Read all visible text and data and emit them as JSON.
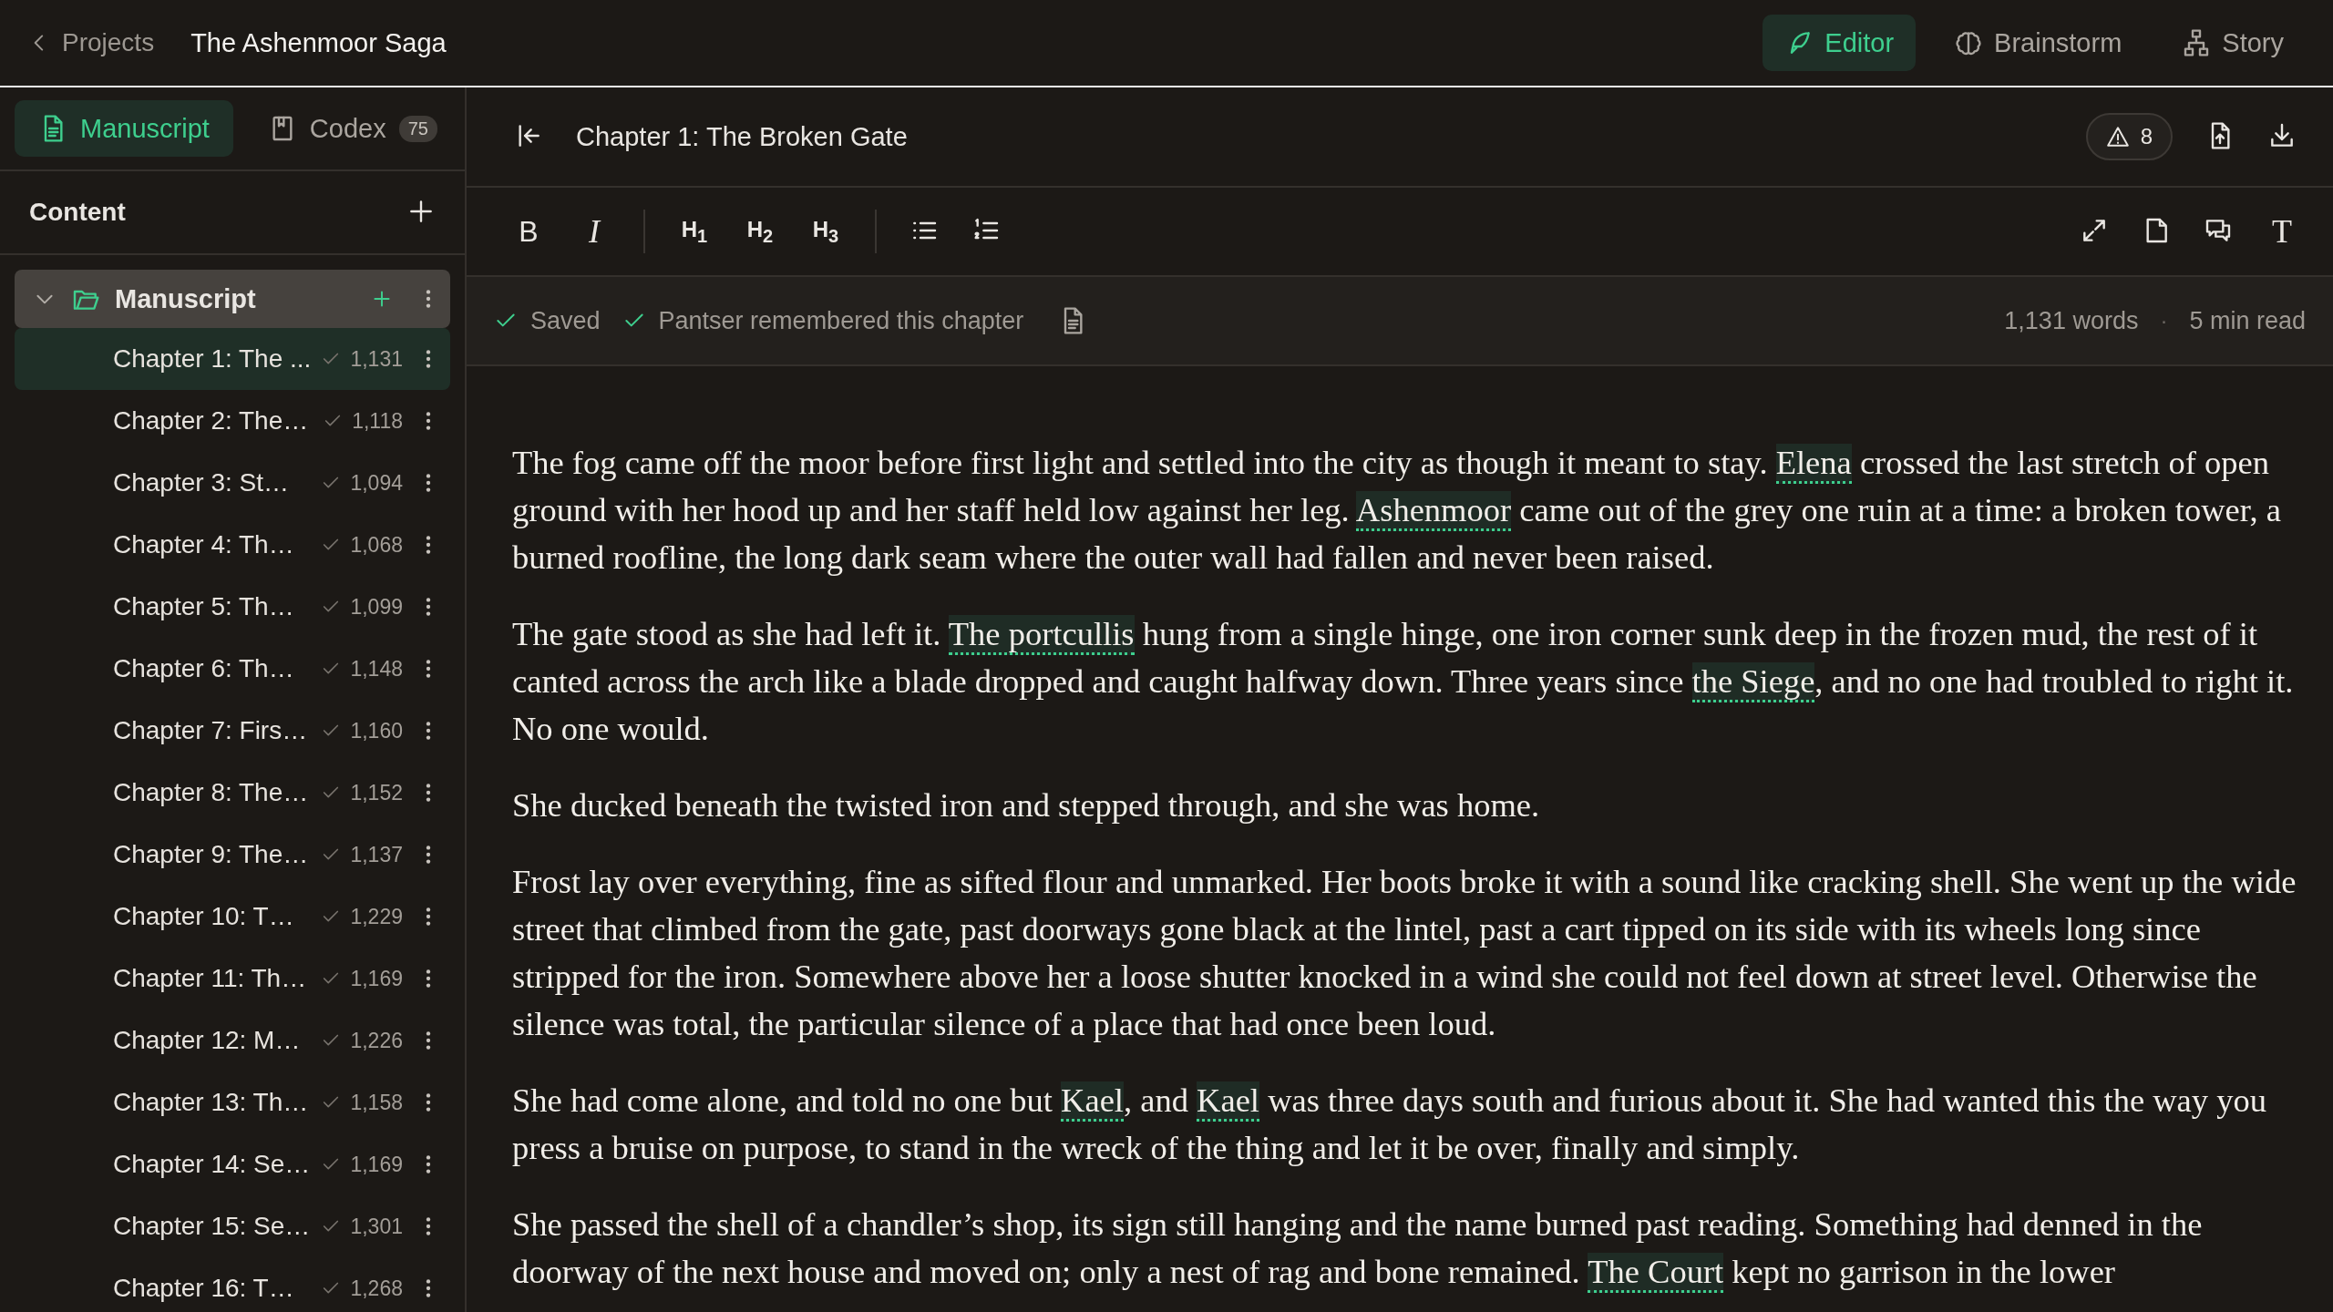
{
  "nav": {
    "back_label": "Projects",
    "project_title": "The Ashenmoor Saga"
  },
  "mode_tabs": [
    {
      "label": "Editor",
      "selected": true
    },
    {
      "label": "Brainstorm",
      "selected": false
    },
    {
      "label": "Story",
      "selected": false
    }
  ],
  "sidebar": {
    "tabs": [
      {
        "label": "Manuscript",
        "selected": true
      },
      {
        "label": "Codex",
        "count": "75",
        "selected": false
      }
    ],
    "section_title": "Content",
    "folder": {
      "label": "Manuscript",
      "expanded": true,
      "children": [
        {
          "title": "Chapter 1: The ...",
          "words": "1,131",
          "selected": true
        },
        {
          "title": "Chapter 2: The…",
          "words": "1,118",
          "selected": false
        },
        {
          "title": "Chapter 3: St…",
          "words": "1,094",
          "selected": false
        },
        {
          "title": "Chapter 4: Th…",
          "words": "1,068",
          "selected": false
        },
        {
          "title": "Chapter 5: Th…",
          "words": "1,099",
          "selected": false
        },
        {
          "title": "Chapter 6: Th…",
          "words": "1,148",
          "selected": false
        },
        {
          "title": "Chapter 7: Firs…",
          "words": "1,160",
          "selected": false
        },
        {
          "title": "Chapter 8: The…",
          "words": "1,152",
          "selected": false
        },
        {
          "title": "Chapter 9: The…",
          "words": "1,137",
          "selected": false
        },
        {
          "title": "Chapter 10: T…",
          "words": "1,229",
          "selected": false
        },
        {
          "title": "Chapter 11: Th…",
          "words": "1,169",
          "selected": false
        },
        {
          "title": "Chapter 12: M…",
          "words": "1,226",
          "selected": false
        },
        {
          "title": "Chapter 13: Th…",
          "words": "1,158",
          "selected": false
        },
        {
          "title": "Chapter 14: Se…",
          "words": "1,169",
          "selected": false
        },
        {
          "title": "Chapter 15: Se…",
          "words": "1,301",
          "selected": false
        },
        {
          "title": "Chapter 16: T…",
          "words": "1,268",
          "selected": false
        }
      ]
    }
  },
  "chapter": {
    "title": "Chapter 1: The Broken Gate",
    "warnings": "8"
  },
  "toolbar": {
    "format_buttons": [
      "B",
      "I",
      "H$_{1}$",
      "H$_{2}$",
      "H$_{3}$"
    ],
    "text_style_button": "T"
  },
  "status": {
    "saved": "Saved",
    "memory": "Pantser remembered this chapter",
    "word_count": "1,131 words",
    "separator": "·",
    "read_time": "5 min read"
  },
  "paragraphs": [
    [
      {
        "text": "The fog came off the moor before first light and settled into the city as though it meant to stay. "
      },
      {
        "text": "Elena",
        "entity": true
      },
      {
        "text": " crossed the last stretch of open ground with her hood up and her staff held low against her leg. "
      },
      {
        "text": "Ashenmoor",
        "entity": true
      },
      {
        "text": " came out of the grey one ruin at a time: a broken tower, a burned roofline, the long dark seam where the outer wall had fallen and never been raised."
      }
    ],
    [
      {
        "text": "The gate stood as she had left it. "
      },
      {
        "text": "The portcullis",
        "entity": true
      },
      {
        "text": " hung from a single hinge, one iron corner sunk deep in the frozen mud, the rest of it canted across the arch like a blade dropped and caught halfway down. Three years since "
      },
      {
        "text": "the Siege",
        "entity": true
      },
      {
        "text": ", and no one had troubled to right it. No one would."
      }
    ],
    [
      {
        "text": "She ducked beneath the twisted iron and stepped through, and she was home."
      }
    ],
    [
      {
        "text": "Frost lay over everything, fine as sifted flour and unmarked. Her boots broke it with a sound like cracking shell. She went up the wide street that climbed from the gate, past doorways gone black at the lintel, past a cart tipped on its side with its wheels long since stripped for the iron. Somewhere above her a loose shutter knocked in a wind she could not feel down at street level. Otherwise the silence was total, the particular silence of a place that had once been loud."
      }
    ],
    [
      {
        "text": "She had come alone, and told no one but "
      },
      {
        "text": "Kael",
        "entity": true
      },
      {
        "text": ", and "
      },
      {
        "text": "Kael",
        "entity": true
      },
      {
        "text": " was three days south and furious about it. She had wanted this the way you press a bruise on purpose, to stand in the wreck of the thing and let it be over, finally and simply."
      }
    ],
    [
      {
        "text": "She passed the shell of a chandler’s shop, its sign still hanging and the name burned past reading. Something had denned in the doorway of the next house and moved on; only a nest of rag and bone remained. "
      },
      {
        "text": "The Court",
        "entity": true
      },
      {
        "text": " kept no garrison in the lower"
      }
    ]
  ]
}
